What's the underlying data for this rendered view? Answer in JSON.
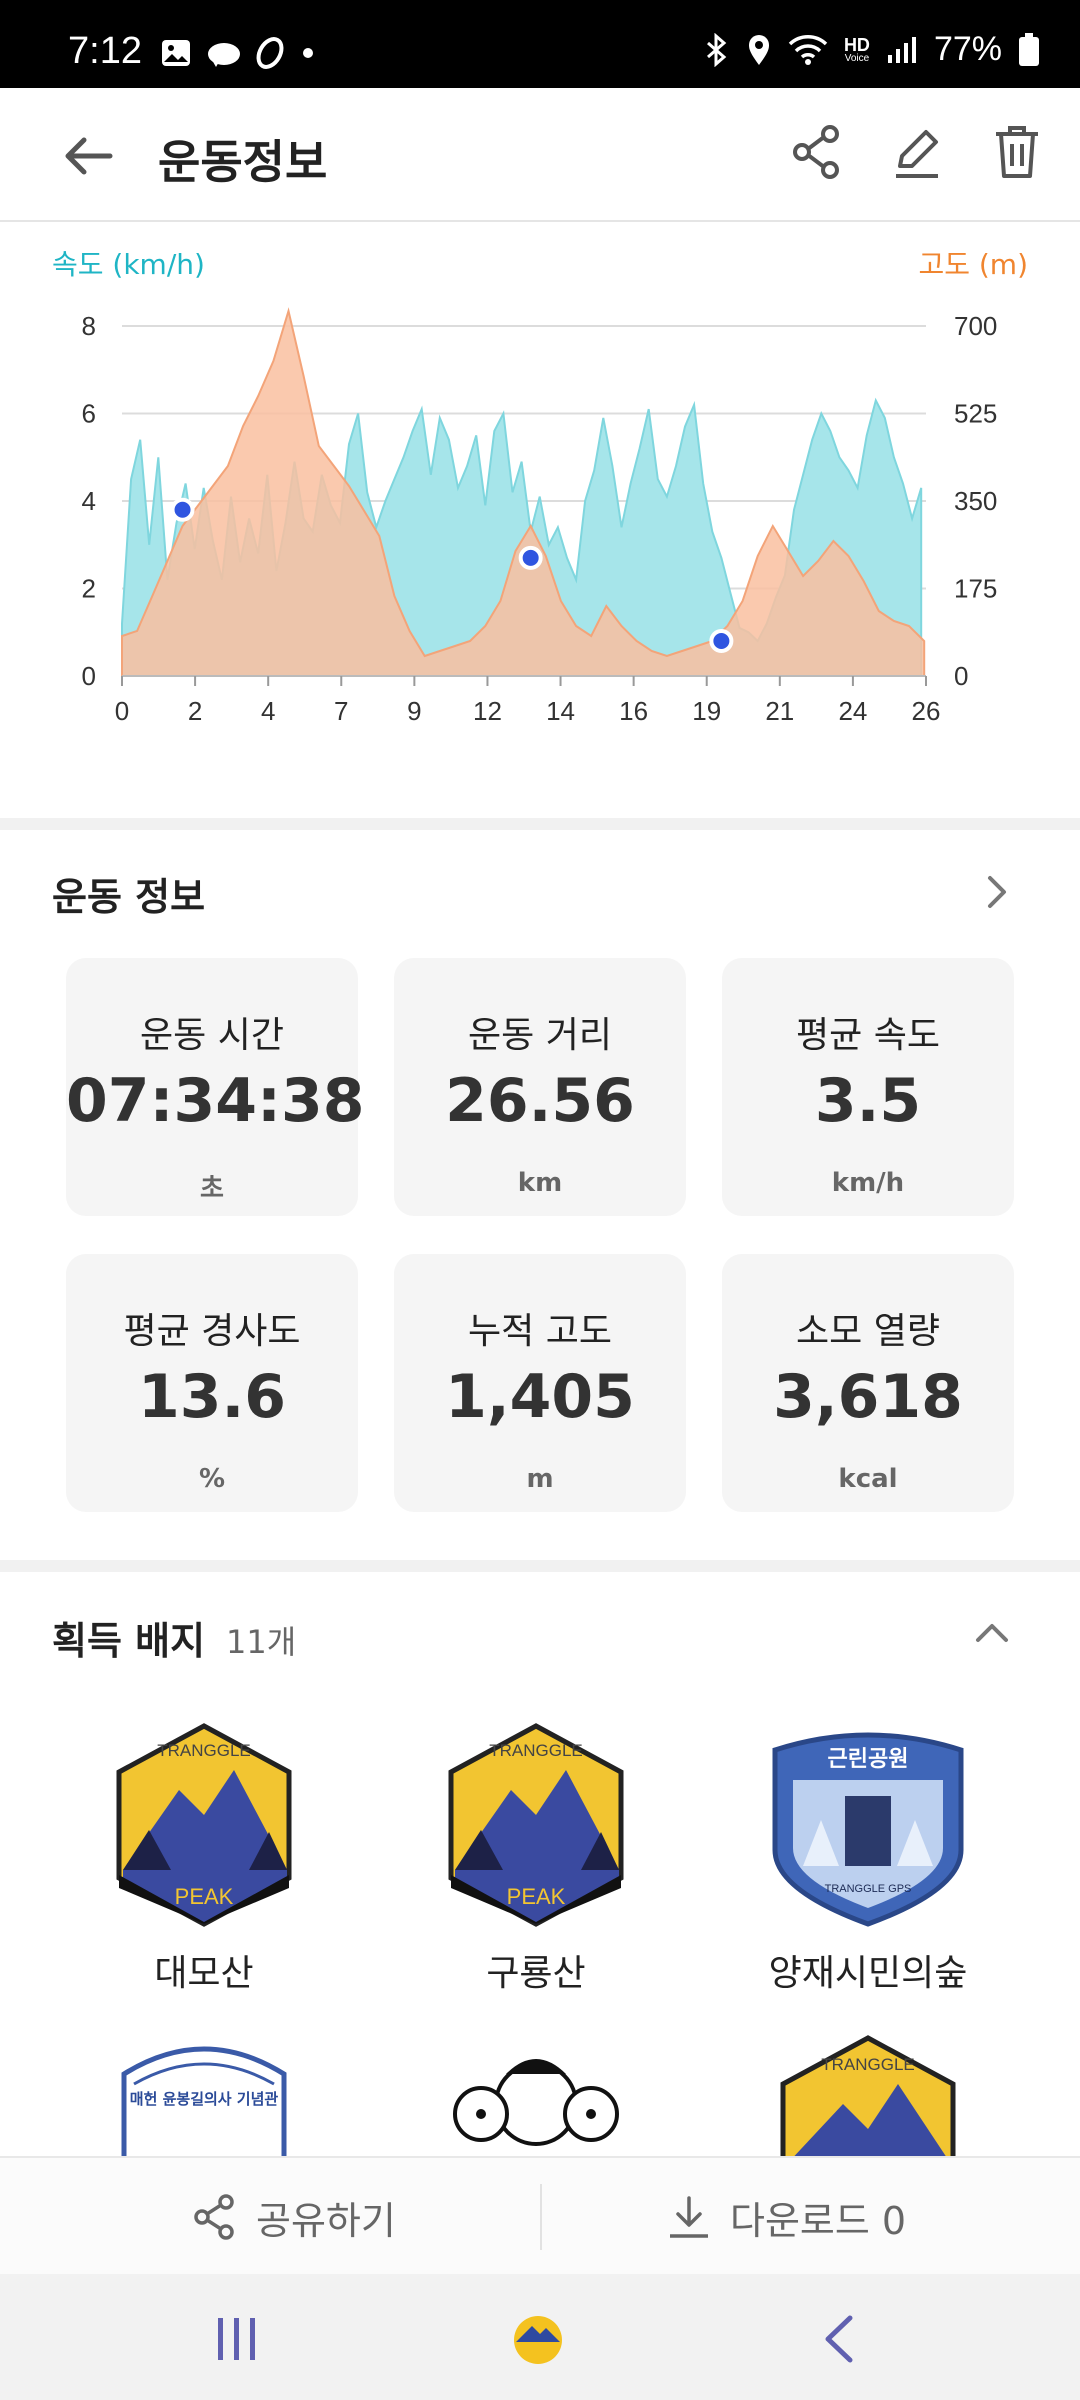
{
  "status": {
    "time": "7:12",
    "battery": "77%",
    "hd_label": "HD",
    "hd_sub": "Voice",
    "icons": [
      "gallery-icon",
      "cloud-icon",
      "shoe-icon",
      "dot-icon",
      "bluetooth-icon",
      "location-icon",
      "wifi-icon",
      "signal-icon",
      "battery-icon"
    ]
  },
  "appbar": {
    "title": "운동정보",
    "actions": [
      "share-icon",
      "edit-icon",
      "trash-icon"
    ]
  },
  "chart": {
    "left_label": "속도 (km/h)",
    "right_label": "고도 (m)",
    "left_color": "#1fb5c5",
    "right_color": "#f0852f",
    "speed_fill": "#a6e5ea",
    "alt_fill": "#f9c0a0",
    "overlap_fill": "#c2b8a2"
  },
  "chart_data": {
    "type": "area",
    "x_ticks": [
      "0",
      "2",
      "4",
      "7",
      "9",
      "12",
      "14",
      "16",
      "19",
      "21",
      "24",
      "26"
    ],
    "y_left_ticks": [
      "8",
      "6",
      "4",
      "2",
      "0"
    ],
    "y_right_ticks": [
      "700",
      "525",
      "350",
      "175",
      "0"
    ],
    "ylim_left": [
      0,
      8
    ],
    "ylim_right": [
      0,
      700
    ],
    "xlim": [
      0,
      26.56
    ],
    "grid": true,
    "series": [
      {
        "axis": "left",
        "x": [
          0,
          0.3,
          0.6,
          0.9,
          1.2,
          1.5,
          1.8,
          2.1,
          2.4,
          2.7,
          3.0,
          3.3,
          3.6,
          3.9,
          4.2,
          4.5,
          4.8,
          5.1,
          5.4,
          5.7,
          6.0,
          6.3,
          6.6,
          6.9,
          7.2,
          7.5,
          7.8,
          8.1,
          8.4,
          8.7,
          9.0,
          9.3,
          9.6,
          9.9,
          10.2,
          10.5,
          10.8,
          11.1,
          11.4,
          11.7,
          12.0,
          12.3,
          12.6,
          12.9,
          13.2,
          13.5,
          13.8,
          14.1,
          14.4,
          14.7,
          15.0,
          15.3,
          15.6,
          15.9,
          16.2,
          16.5,
          16.8,
          17.1,
          17.4,
          17.7,
          18.0,
          18.3,
          18.6,
          18.9,
          19.2,
          19.5,
          19.8,
          20.1,
          20.4,
          20.7,
          21.0,
          21.3,
          21.6,
          21.9,
          22.2,
          22.5,
          22.8,
          23.1,
          23.4,
          23.7,
          24.0,
          24.3,
          24.6,
          24.9,
          25.2,
          25.5,
          25.8,
          26.1,
          26.4
        ],
        "y": [
          1.2,
          4.5,
          5.4,
          3.0,
          5.0,
          2.2,
          3.5,
          4.4,
          2.9,
          4.3,
          3.1,
          2.2,
          4.1,
          2.6,
          3.6,
          2.8,
          4.6,
          2.4,
          3.5,
          4.9,
          3.6,
          3.3,
          4.6,
          3.9,
          3.5,
          5.3,
          6.0,
          4.2,
          3.4,
          4.0,
          4.5,
          5.0,
          5.6,
          6.1,
          4.6,
          5.9,
          5.4,
          4.3,
          4.8,
          5.5,
          3.9,
          5.6,
          6.0,
          4.2,
          4.9,
          3.3,
          4.1,
          3.0,
          3.4,
          2.7,
          2.2,
          4.0,
          4.7,
          5.9,
          4.8,
          3.4,
          4.4,
          5.2,
          6.1,
          4.5,
          4.1,
          4.8,
          5.7,
          6.2,
          4.4,
          3.3,
          2.7,
          1.9,
          1.1,
          1.0,
          0.8,
          1.2,
          1.8,
          2.3,
          3.8,
          4.6,
          5.4,
          6.0,
          5.6,
          5.0,
          4.7,
          4.3,
          5.5,
          6.3,
          5.9,
          5.0,
          4.4,
          3.6,
          4.3
        ],
        "name": "속도"
      },
      {
        "axis": "right",
        "x": [
          0,
          0.5,
          1.0,
          1.5,
          2.0,
          2.5,
          3.0,
          3.5,
          4.0,
          4.5,
          5.0,
          5.5,
          6.0,
          6.5,
          7.0,
          7.5,
          8.0,
          8.5,
          9.0,
          9.5,
          10.0,
          10.5,
          11.0,
          11.5,
          12.0,
          12.5,
          13.0,
          13.5,
          14.0,
          14.5,
          15.0,
          15.5,
          16.0,
          16.5,
          17.0,
          17.5,
          18.0,
          18.5,
          19.0,
          19.5,
          20.0,
          20.5,
          21.0,
          21.5,
          22.0,
          22.5,
          23.0,
          23.5,
          24.0,
          24.5,
          25.0,
          25.5,
          26.0,
          26.5
        ],
        "y": [
          80,
          90,
          160,
          230,
          300,
          340,
          380,
          420,
          500,
          560,
          630,
          730,
          600,
          460,
          420,
          380,
          330,
          280,
          160,
          90,
          40,
          50,
          60,
          70,
          100,
          150,
          250,
          300,
          240,
          150,
          100,
          80,
          140,
          100,
          70,
          50,
          40,
          50,
          60,
          70,
          100,
          150,
          240,
          300,
          250,
          200,
          230,
          270,
          240,
          190,
          130,
          110,
          100,
          70
        ],
        "name": "고도"
      }
    ],
    "markers": [
      {
        "x": 2.0,
        "y": 3.8
      },
      {
        "x": 13.5,
        "y": 2.7
      },
      {
        "x": 19.8,
        "y": 0.8
      }
    ]
  },
  "summary": {
    "title": "운동 정보",
    "cards": [
      {
        "label": "운동 시간",
        "value": "07:34:38",
        "unit": "초"
      },
      {
        "label": "운동 거리",
        "value": "26.56",
        "unit": "km"
      },
      {
        "label": "평균 속도",
        "value": "3.5",
        "unit": "km/h"
      },
      {
        "label": "평균 경사도",
        "value": "13.6",
        "unit": "%"
      },
      {
        "label": "누적 고도",
        "value": "1,405",
        "unit": "m"
      },
      {
        "label": "소모 열량",
        "value": "3,618",
        "unit": "kcal"
      }
    ]
  },
  "badges": {
    "title": "획득 배지",
    "count": "11개",
    "items": [
      {
        "name": "대모산",
        "top_text": "TRANGGLE",
        "bottom_text": "PEAK"
      },
      {
        "name": "구룡산",
        "top_text": "TRANGGLE",
        "bottom_text": "PEAK"
      },
      {
        "name": "양재시민의숲",
        "top_text": "근린공원",
        "bottom_text": "TRANGGLE GPS"
      },
      {
        "name": "",
        "top_text": "매헌 윤봉길의사 기념관",
        "bottom_text": ""
      },
      {
        "name": "",
        "top_text": "",
        "bottom_text": ""
      },
      {
        "name": "",
        "top_text": "TRANGGLE",
        "bottom_text": ""
      }
    ]
  },
  "bottom_actions": {
    "share_label": "공유하기",
    "download_label": "다운로드 0"
  },
  "navbar": {
    "items": [
      "recent-apps-icon",
      "home-icon",
      "back-nav-icon"
    ]
  }
}
